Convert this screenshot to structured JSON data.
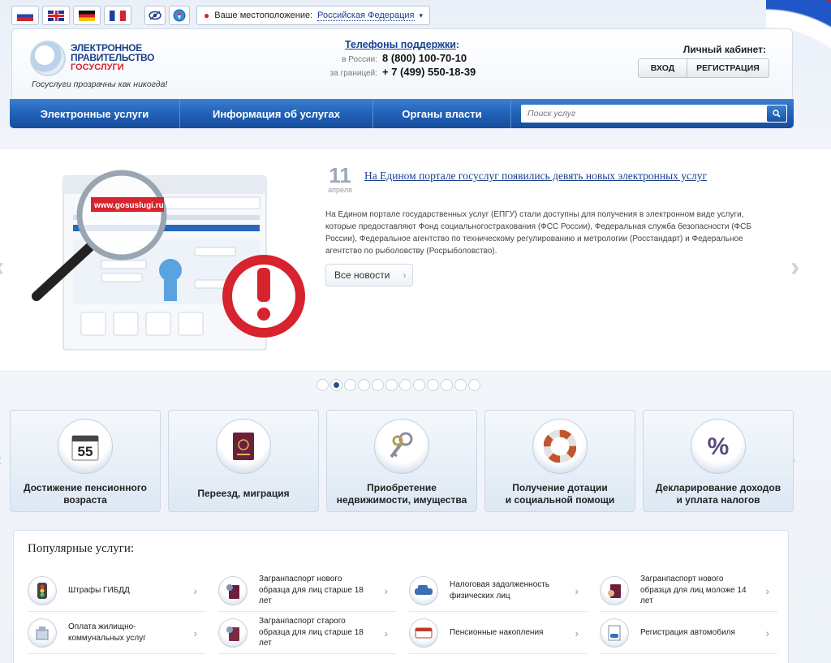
{
  "topbar": {
    "location_label": "Ваше местоположение:",
    "location_value": "Российская Федерация"
  },
  "header": {
    "logo_line1": "ЭЛЕКТРОННОЕ",
    "logo_line2": "ПРАВИТЕЛЬСТВО",
    "logo_line3": "ГОСУСЛУГИ",
    "tagline": "Госуслуги прозрачны как никогда!",
    "phones_title": "Телефоны поддержки",
    "phones": [
      {
        "label": "в России:",
        "number": "8 (800) 100-70-10"
      },
      {
        "label": "за границей:",
        "number": "+ 7 (499) 550-18-39"
      }
    ],
    "cabinet_title": "Личный кабинет:",
    "login_label": "ВХОД",
    "register_label": "РЕГИСТРАЦИЯ"
  },
  "nav": {
    "items": [
      "Электронные услуги",
      "Информация об услугах",
      "Органы власти"
    ],
    "search_placeholder": "Поиск услуг"
  },
  "news": {
    "day": "11",
    "month": "апреля",
    "title": "На Едином портале госуслуг появились девять новых электронных услуг",
    "body": "На Едином портале государственных услуг (ЕПГУ) стали доступны для получения в электронном виде услуги, которые предоставляют Фонд социальногострахования (ФСС России), Федеральная служба безопасности (ФСБ России), Федеральное агентство по техническому регулированию и метрологии (Росстандарт) и Федеральное агентство по рыболовству (Росрыболовство).",
    "all_news_label": "Все новости",
    "illustration_url": "www.gosuslugi.ru",
    "active_slide": 2,
    "total_slides": 12
  },
  "categories": [
    {
      "line1": "Достижение пенсионного",
      "line2": "возраста",
      "icon": "calendar-55-icon"
    },
    {
      "line1": "Переезд, миграция",
      "line2": "",
      "icon": "passport-icon"
    },
    {
      "line1": "Приобретение",
      "line2": "недвижимости, имущества",
      "icon": "keys-icon"
    },
    {
      "line1": "Получение дотации",
      "line2": "и социальной помощи",
      "icon": "lifebuoy-icon"
    },
    {
      "line1": "Декларирование доходов",
      "line2": "и уплата налогов",
      "icon": "percent-icon"
    }
  ],
  "popular": {
    "title": "Популярные услуги:",
    "items": [
      {
        "text": "Штрафы ГИБДД",
        "icon": "traffic-light-icon"
      },
      {
        "text": "Загранпаспорт нового образца для лиц старше 18 лет",
        "icon": "passport-person-icon"
      },
      {
        "text": "Налоговая задолженность физических лиц",
        "icon": "tax-car-icon"
      },
      {
        "text": "Загранпаспорт нового образца для лиц моложе 14 лет",
        "icon": "passport-child-icon"
      },
      {
        "text": "Оплата жилищно-коммунальных услуг",
        "icon": "utilities-icon"
      },
      {
        "text": "Загранпаспорт старого образца для лиц старше 18 лет",
        "icon": "passport-old-icon"
      },
      {
        "text": "Пенсионные накопления",
        "icon": "pension-icon"
      },
      {
        "text": "Регистрация автомобиля",
        "icon": "car-document-icon"
      }
    ]
  },
  "colors": {
    "nav_blue": "#1f5fb5",
    "link_blue": "#1a3f8f",
    "accent_red": "#d6232d"
  }
}
